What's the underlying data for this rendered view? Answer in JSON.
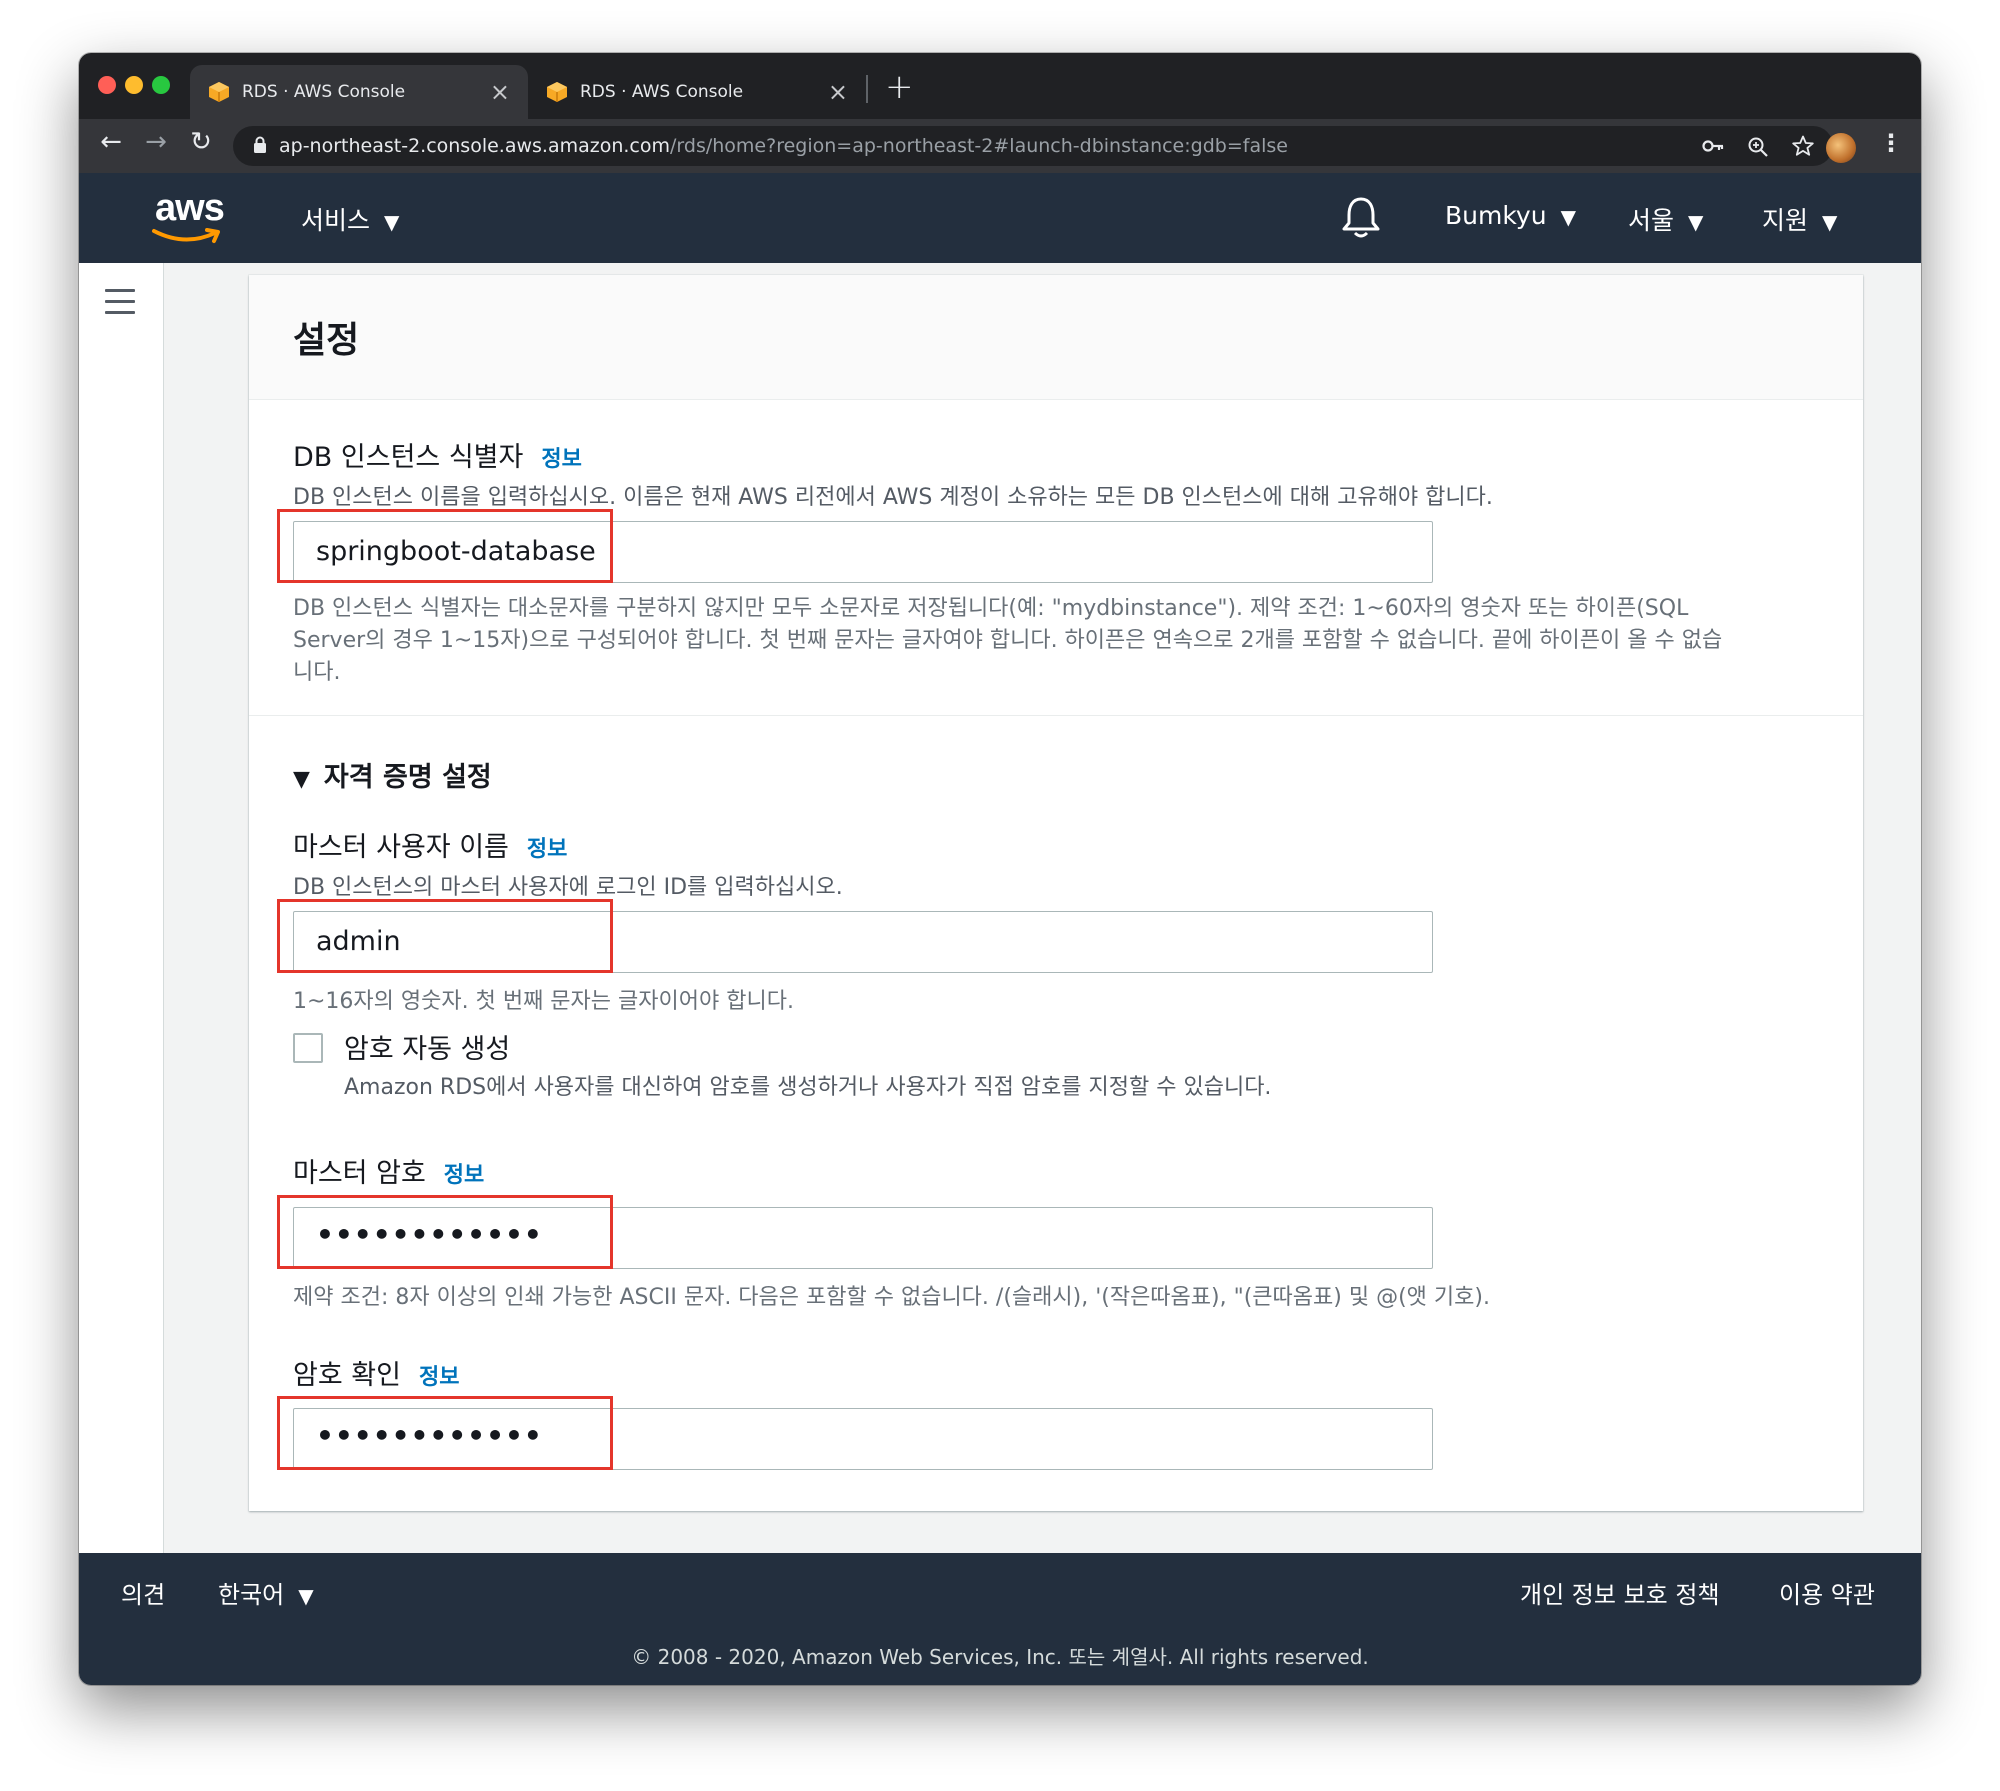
{
  "browser": {
    "tabs": [
      {
        "title": "RDS · AWS Console",
        "close": "×"
      },
      {
        "title": "RDS · AWS Console",
        "close": "×"
      }
    ],
    "new_tab": "+",
    "nav": {
      "back": "←",
      "forward": "→",
      "reload": "↻"
    },
    "url_host": "ap-northeast-2.console.aws.amazon.com",
    "url_path": "/rds/home?region=ap-northeast-2#launch-dbinstance:gdb=false",
    "icons": {
      "key": "key-icon",
      "zoom": "zoom-icon",
      "star": "star-icon",
      "menu": "⋮"
    }
  },
  "aws_header": {
    "logo": "aws",
    "services": "서비스",
    "account": "Bumkyu",
    "region": "서울",
    "support": "지원",
    "caret": "▼"
  },
  "panel": {
    "title": "설정",
    "info": "정보",
    "db_identifier": {
      "label": "DB 인스턴스 식별자",
      "description": "DB 인스턴스 이름을 입력하십시오. 이름은 현재 AWS 리전에서 AWS 계정이 소유하는 모든 DB 인스턴스에 대해 고유해야 합니다.",
      "value": "springboot-database",
      "hint_line1": "DB 인스턴스 식별자는 대소문자를 구분하지 않지만 모두 소문자로 저장됩니다(예: \"mydbinstance\"). 제약 조건: 1~60자의 영숫자 또는 하이픈(SQL",
      "hint_line2": "Server의 경우 1~15자)으로 구성되어야 합니다. 첫 번째 문자는 글자여야 합니다. 하이픈은 연속으로 2개를 포함할 수 없습니다. 끝에 하이픈이 올 수 없습",
      "hint_line3": "니다."
    },
    "credentials": {
      "toggle_icon": "▼",
      "section_title": "자격 증명 설정",
      "master_username": {
        "label": "마스터 사용자 이름",
        "description": "DB 인스턴스의 마스터 사용자에 로그인 ID를 입력하십시오.",
        "value": "admin",
        "hint": "1~16자의 영숫자. 첫 번째 문자는 글자이어야 합니다."
      },
      "auto_password": {
        "label": "암호 자동 생성",
        "checked": false,
        "description": "Amazon RDS에서 사용자를 대신하여 암호를 생성하거나 사용자가 직접 암호를 지정할 수 있습니다."
      },
      "master_password": {
        "label": "마스터 암호",
        "value": "••••••••••••",
        "hint": "제약 조건: 8자 이상의 인쇄 가능한 ASCII 문자. 다음은 포함할 수 없습니다. /(슬래시), '(작은따옴표), \"(큰따옴표) 및 @(앳 기호)."
      },
      "confirm_password": {
        "label": "암호 확인",
        "value": "••••••••••••"
      }
    }
  },
  "footer": {
    "feedback": "의견",
    "language": "한국어",
    "privacy": "개인 정보 보호 정책",
    "terms": "이용 약관",
    "copyright": "© 2008 - 2020, Amazon Web Services, Inc. 또는 계열사. All rights reserved."
  },
  "colors": {
    "aws_navy": "#232f3e",
    "link_blue": "#0073bb",
    "highlight_red": "#e4352b",
    "aws_orange": "#ff9900"
  }
}
